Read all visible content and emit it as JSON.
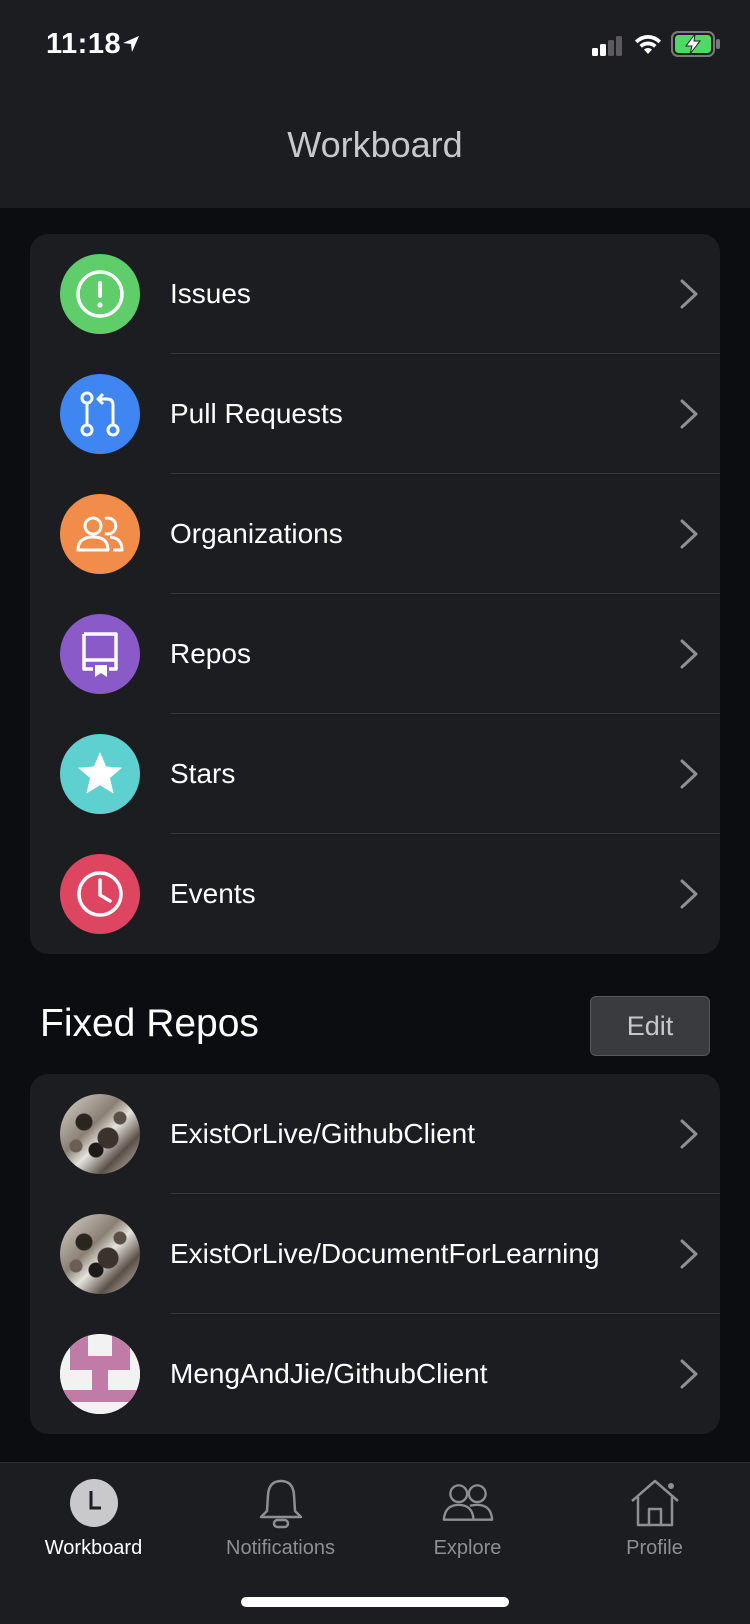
{
  "status_bar": {
    "time": "11:18"
  },
  "nav": {
    "title": "Workboard"
  },
  "menu": [
    {
      "label": "Issues",
      "icon": "issue-icon",
      "color": "#5fce6a"
    },
    {
      "label": "Pull Requests",
      "icon": "pull-request-icon",
      "color": "#3f86f2"
    },
    {
      "label": "Organizations",
      "icon": "people-icon",
      "color": "#f28c4a"
    },
    {
      "label": "Repos",
      "icon": "repo-icon",
      "color": "#8a5ac9"
    },
    {
      "label": "Stars",
      "icon": "star-icon",
      "color": "#5fd0d0"
    },
    {
      "label": "Events",
      "icon": "clock-icon",
      "color": "#dd4560"
    }
  ],
  "fixed_repos": {
    "title": "Fixed Repos",
    "edit_label": "Edit",
    "items": [
      {
        "label": "ExistOrLive/GithubClient",
        "avatar": "photo-avatar"
      },
      {
        "label": "ExistOrLive/DocumentForLearning",
        "avatar": "photo-avatar"
      },
      {
        "label": "MengAndJie/GithubClient",
        "avatar": "identicon-avatar"
      }
    ]
  },
  "tabs": [
    {
      "label": "Workboard",
      "icon": "clock-icon",
      "active": true
    },
    {
      "label": "Notifications",
      "icon": "bell-icon",
      "active": false
    },
    {
      "label": "Explore",
      "icon": "people-icon",
      "active": false
    },
    {
      "label": "Profile",
      "icon": "home-icon",
      "active": false
    }
  ]
}
